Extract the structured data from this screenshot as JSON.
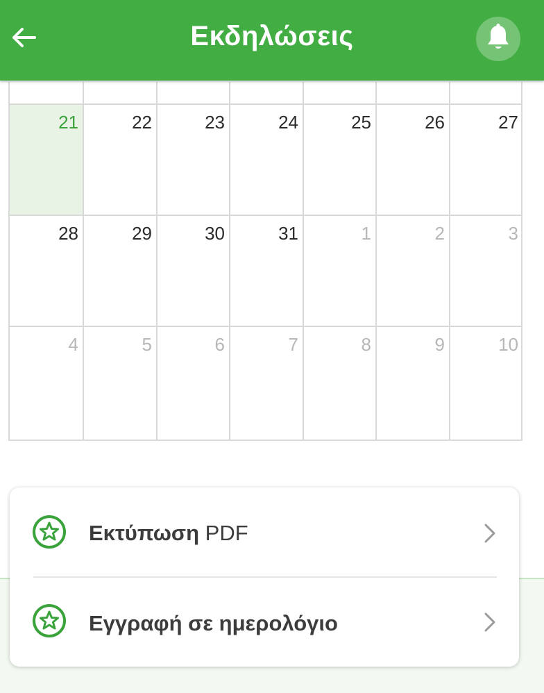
{
  "header": {
    "title": "Εκδηλώσεις",
    "back_icon": "arrow-left-icon",
    "bell_icon": "bell-icon",
    "color": "#41ad42"
  },
  "calendar": {
    "weeks": [
      [
        {
          "day": "",
          "muted": false,
          "today": false
        },
        {
          "day": "",
          "muted": false,
          "today": false
        },
        {
          "day": "",
          "muted": false,
          "today": false
        },
        {
          "day": "",
          "muted": false,
          "today": false
        },
        {
          "day": "",
          "muted": false,
          "today": false
        },
        {
          "day": "",
          "muted": false,
          "today": false
        },
        {
          "day": "",
          "muted": false,
          "today": false
        }
      ],
      [
        {
          "day": "21",
          "muted": false,
          "today": true
        },
        {
          "day": "22",
          "muted": false,
          "today": false
        },
        {
          "day": "23",
          "muted": false,
          "today": false
        },
        {
          "day": "24",
          "muted": false,
          "today": false
        },
        {
          "day": "25",
          "muted": false,
          "today": false
        },
        {
          "day": "26",
          "muted": false,
          "today": false
        },
        {
          "day": "27",
          "muted": false,
          "today": false
        }
      ],
      [
        {
          "day": "28",
          "muted": false,
          "today": false
        },
        {
          "day": "29",
          "muted": false,
          "today": false
        },
        {
          "day": "30",
          "muted": false,
          "today": false
        },
        {
          "day": "31",
          "muted": false,
          "today": false
        },
        {
          "day": "1",
          "muted": true,
          "today": false
        },
        {
          "day": "2",
          "muted": true,
          "today": false
        },
        {
          "day": "3",
          "muted": true,
          "today": false
        }
      ],
      [
        {
          "day": "4",
          "muted": true,
          "today": false
        },
        {
          "day": "5",
          "muted": true,
          "today": false
        },
        {
          "day": "6",
          "muted": true,
          "today": false
        },
        {
          "day": "7",
          "muted": true,
          "today": false
        },
        {
          "day": "8",
          "muted": true,
          "today": false
        },
        {
          "day": "9",
          "muted": true,
          "today": false
        },
        {
          "day": "10",
          "muted": true,
          "today": false
        }
      ]
    ],
    "today_color": "#3aa33b",
    "today_bg": "#e8f3e6"
  },
  "actions": [
    {
      "bold": "Εκτύπωση",
      "rest": " PDF",
      "icon": "star-circle-icon",
      "chevron": "chevron-right-icon"
    },
    {
      "bold": "Εγγραφή σε ημερολόγιο",
      "rest": "",
      "icon": "star-circle-icon",
      "chevron": "chevron-right-icon"
    }
  ]
}
